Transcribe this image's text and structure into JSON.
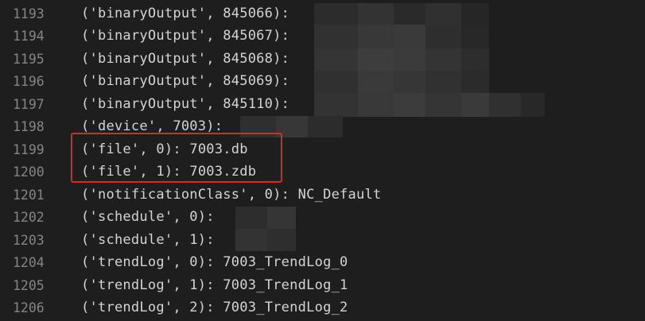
{
  "editor": {
    "lines": [
      {
        "number": "1193",
        "code": "('binaryOutput', 845066):",
        "value": ""
      },
      {
        "number": "1194",
        "code": "('binaryOutput', 845067):",
        "value": ""
      },
      {
        "number": "1195",
        "code": "('binaryOutput', 845068):",
        "value": ""
      },
      {
        "number": "1196",
        "code": "('binaryOutput', 845069):",
        "value": ""
      },
      {
        "number": "1197",
        "code": "('binaryOutput', 845110):",
        "value": ""
      },
      {
        "number": "1198",
        "code": "('device', 7003):",
        "value": ""
      },
      {
        "number": "1199",
        "code": "('file', 0):",
        "value": "7003.db"
      },
      {
        "number": "1200",
        "code": "('file', 1):",
        "value": "7003.zdb"
      },
      {
        "number": "1201",
        "code": "('notificationClass', 0):",
        "value": "NC_Default"
      },
      {
        "number": "1202",
        "code": "('schedule', 0):",
        "value": ""
      },
      {
        "number": "1203",
        "code": "('schedule', 1):",
        "value": ""
      },
      {
        "number": "1204",
        "code": "('trendLog', 0):",
        "value": "7003_TrendLog_0"
      },
      {
        "number": "1205",
        "code": "('trendLog', 1):",
        "value": "7003_TrendLog_1"
      },
      {
        "number": "1206",
        "code": "('trendLog', 2):",
        "value": "7003_TrendLog_2"
      }
    ]
  },
  "colors": {
    "background": "#1e1e1e",
    "line_number": "#858585",
    "text": "#d4d4d4",
    "highlight_border": "#d22b2b"
  }
}
